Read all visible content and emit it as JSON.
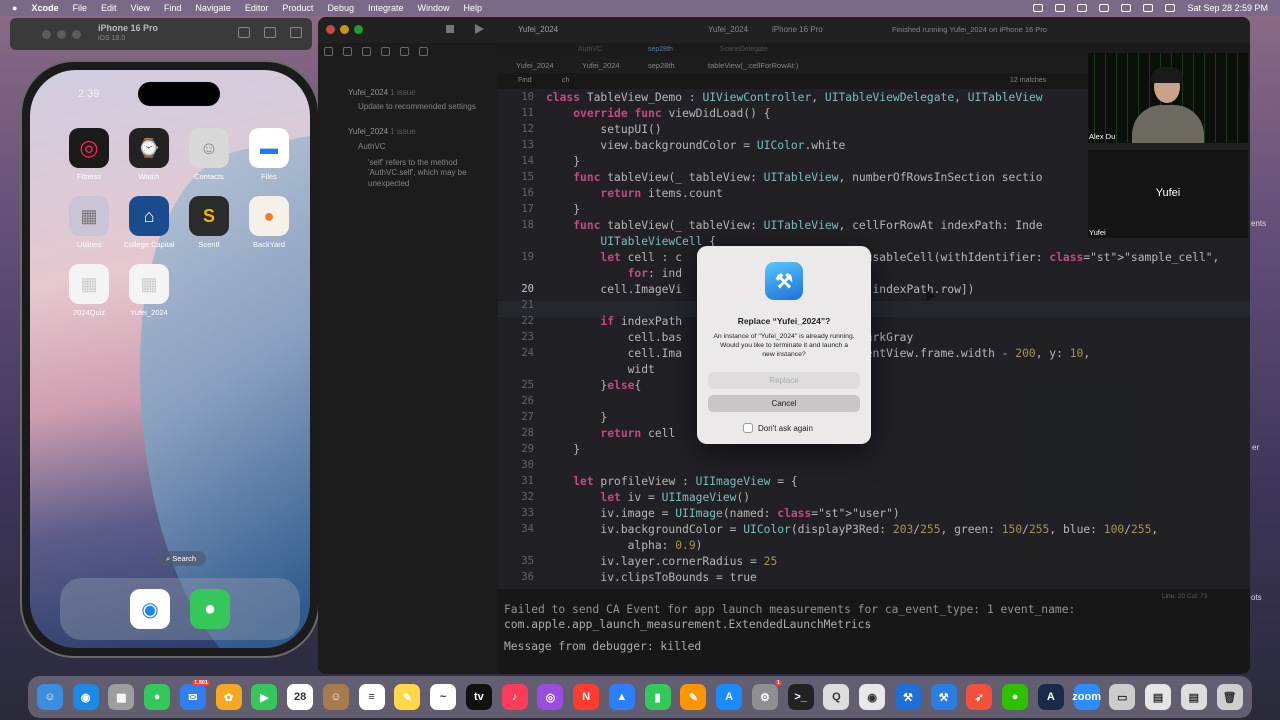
{
  "menubar": {
    "app": "Xcode",
    "items": [
      "File",
      "Edit",
      "View",
      "Find",
      "Navigate",
      "Editor",
      "Product",
      "Debug",
      "Integrate",
      "Window",
      "Help"
    ],
    "clock": "Sat Sep 28  2:59 PM"
  },
  "simulator": {
    "title": "iPhone 16 Pro",
    "subtitle": "iOS 18.0",
    "time": "2:39",
    "apps": [
      {
        "label": "Fitness",
        "icon": "fitness-icon",
        "color": "#1b1b1b",
        "glyph": "◎"
      },
      {
        "label": "Watch",
        "icon": "watch-icon",
        "color": "#222",
        "glyph": "⌚"
      },
      {
        "label": "Contacts",
        "icon": "contacts-icon",
        "color": "#d8d8d8",
        "glyph": "☺"
      },
      {
        "label": "Files",
        "icon": "files-icon",
        "color": "#fff",
        "glyph": "▬"
      },
      {
        "label": "Utilities",
        "icon": "utilities-icon",
        "color": "#c9c4d6",
        "glyph": "▦"
      },
      {
        "label": "College Capital",
        "icon": "college-capital-icon",
        "color": "#1a4b8c",
        "glyph": "⌂"
      },
      {
        "label": "ScenIf",
        "icon": "scenif-icon",
        "color": "#2b2b2b",
        "glyph": "S"
      },
      {
        "label": "BackYard",
        "icon": "backyard-icon",
        "color": "#f5f0e8",
        "glyph": "●"
      },
      {
        "label": "2024Quiz",
        "icon": "quiz-icon",
        "color": "#f4f4f4",
        "glyph": "▦"
      },
      {
        "label": "Yufei_2024",
        "icon": "yufei-app-icon",
        "color": "#f4f4f4",
        "glyph": "▦"
      }
    ],
    "search_label": "Search",
    "dock": [
      {
        "icon": "safari-icon",
        "glyph": "◉",
        "color": "#fff"
      },
      {
        "icon": "messages-icon",
        "glyph": "●",
        "color": "#35c759"
      }
    ]
  },
  "xcode": {
    "project": "Yufei_2024",
    "scheme": "Yufei_2024",
    "device": "iPhone 16 Pro",
    "status": "Finished running Yufei_2024 on iPhone 16 Pro",
    "tabs": [
      "AuthVC",
      "sep28th",
      "SceneDelegate"
    ],
    "jumpbar": [
      "Yufei_2024",
      "Yufei_2024",
      "sep28th",
      "tableView(_:cellForRowAt:)"
    ],
    "find_label": "Find",
    "find_value": "ch",
    "find_matches": "12 matches",
    "issues": {
      "group1": "Yufei_2024",
      "group1_count": "1 issue",
      "item1": "Update to recommended settings",
      "group2": "Yufei_2024",
      "group2_count": "1 issue",
      "file": "AuthVC",
      "item2": "'self' refers to the method 'AuthVC.self', which may be unexpected"
    },
    "line_col": "Line: 20  Col: 73",
    "console": [
      "Failed to send CA Event for app launch measurements for ca_event_type: 1 event_name:",
      "com.apple.app_launch_measurement.ExtendedLaunchMetrics",
      "Message from debugger: killed"
    ]
  },
  "code_lines": [
    {
      "n": "10",
      "t": "class TableView_Demo : UIViewController, UITableViewDelegate, UITableView"
    },
    {
      "n": "11",
      "t": "    override func viewDidLoad() {"
    },
    {
      "n": "12",
      "t": "        setupUI()"
    },
    {
      "n": "13",
      "t": "        view.backgroundColor = UIColor.white"
    },
    {
      "n": "14",
      "t": "    }"
    },
    {
      "n": "15",
      "t": "    func tableView(_ tableView: UITableView, numberOfRowsInSection sectio"
    },
    {
      "n": "16",
      "t": "        return items.count"
    },
    {
      "n": "17",
      "t": "    }"
    },
    {
      "n": "18",
      "t": "    func tableView(_ tableView: UITableView, cellForRowAt indexPath: Inde"
    },
    {
      "n": "",
      "t": "        UITableViewCell {"
    },
    {
      "n": "19",
      "t": "        let cell : c                  dequeueReusableCell(withIdentifier: \"sample_cell\","
    },
    {
      "n": "",
      "t": "            for: ind                  cell"
    },
    {
      "n": "20",
      "t": "        cell.ImageVi              emName:images[indexPath.row])"
    },
    {
      "n": "21",
      "t": ""
    },
    {
      "n": "22",
      "t": "        if indexPath"
    },
    {
      "n": "23",
      "t": "            cell.bas                  UIColor.darkGray"
    },
    {
      "n": "24",
      "t": "            cell.Ima                : cell.contentView.frame.width - 200, y: 10,"
    },
    {
      "n": "",
      "t": "            widt"
    },
    {
      "n": "25",
      "t": "        }else{"
    },
    {
      "n": "26",
      "t": ""
    },
    {
      "n": "27",
      "t": "        }"
    },
    {
      "n": "28",
      "t": "        return cell"
    },
    {
      "n": "29",
      "t": "    }"
    },
    {
      "n": "30",
      "t": ""
    },
    {
      "n": "31",
      "t": "    let profileView : UIImageView = {"
    },
    {
      "n": "32",
      "t": "        let iv = UIImageView()"
    },
    {
      "n": "33",
      "t": "        iv.image = UIImage(named: \"user\")"
    },
    {
      "n": "34",
      "t": "        iv.backgroundColor = UIColor(displayP3Red: 203/255, green: 150/255, blue: 100/255,"
    },
    {
      "n": "",
      "t": "            alpha: 0.9)"
    },
    {
      "n": "35",
      "t": "        iv.layer.cornerRadius = 25"
    },
    {
      "n": "36",
      "t": "        iv.clipsToBounds = true"
    }
  ],
  "dialog": {
    "icon": "xcode-app-icon",
    "title": "Replace “Yufei_2024”?",
    "message": "An instance of \"Yufei_2024\" is already running. Would you like to terminate it and launch a new instance?",
    "replace": "Replace",
    "cancel": "Cancel",
    "checkbox": "Don't ask again"
  },
  "video": {
    "tile1_name": "Alex Du",
    "tile2_label": "Yufei",
    "tile2_name": "Yufei"
  },
  "edge_labels": [
    "ents",
    "er",
    "ots"
  ],
  "dock_apps": [
    {
      "icon": "finder-icon",
      "color": "#3b8de0",
      "txt": "☺"
    },
    {
      "icon": "safari-icon",
      "color": "#1e88e5",
      "txt": "◉"
    },
    {
      "icon": "launchpad-icon",
      "color": "#9e9e9e",
      "txt": "▦"
    },
    {
      "icon": "messages-icon",
      "color": "#34c759",
      "txt": "●"
    },
    {
      "icon": "mail-icon",
      "color": "#2f7ff0",
      "txt": "✉",
      "badge": "1,801"
    },
    {
      "icon": "photos-icon",
      "color": "#f5a623",
      "txt": "✿"
    },
    {
      "icon": "facetime-icon",
      "color": "#34c759",
      "txt": "▶"
    },
    {
      "icon": "calendar-icon",
      "color": "#ffffff",
      "txt": "28"
    },
    {
      "icon": "contacts-icon",
      "color": "#a87b4f",
      "txt": "☺"
    },
    {
      "icon": "reminders-icon",
      "color": "#ffffff",
      "txt": "≡"
    },
    {
      "icon": "notes-icon",
      "color": "#ffd84a",
      "txt": "✎"
    },
    {
      "icon": "freeform-icon",
      "color": "#ffffff",
      "txt": "~"
    },
    {
      "icon": "appletv-icon",
      "color": "#111111",
      "txt": "tv"
    },
    {
      "icon": "music-icon",
      "color": "#fa3c5a",
      "txt": "♪"
    },
    {
      "icon": "podcasts-icon",
      "color": "#9b4dde",
      "txt": "◎"
    },
    {
      "icon": "news-icon",
      "color": "#ff3b30",
      "txt": "N"
    },
    {
      "icon": "keynote-icon",
      "color": "#2d7ff9",
      "txt": "▲"
    },
    {
      "icon": "numbers-icon",
      "color": "#34c759",
      "txt": "▮"
    },
    {
      "icon": "pages-icon",
      "color": "#ff9500",
      "txt": "✎"
    },
    {
      "icon": "appstore-icon",
      "color": "#1a8cff",
      "txt": "A"
    },
    {
      "icon": "settings-icon",
      "color": "#8e8e93",
      "txt": "⚙",
      "badge": "1"
    },
    {
      "icon": "terminal-icon",
      "color": "#222222",
      "txt": ">_"
    },
    {
      "icon": "quicktime-icon",
      "color": "#dddddd",
      "txt": "Q"
    },
    {
      "icon": "chrome-icon",
      "color": "#e8e8e8",
      "txt": "◉"
    },
    {
      "icon": "xcode-icon",
      "color": "#1e6fd8",
      "txt": "⚒"
    },
    {
      "icon": "xcode-beta-icon",
      "color": "#2a7de1",
      "txt": "⚒"
    },
    {
      "icon": "swift-playgrounds-icon",
      "color": "#f05138",
      "txt": "➶"
    },
    {
      "icon": "wechat-icon",
      "color": "#2dc100",
      "txt": "●"
    },
    {
      "icon": "instruments-icon",
      "color": "#1c2a4a",
      "txt": "A"
    },
    {
      "icon": "zoom-icon",
      "color": "#2d8cff",
      "txt": "zoom"
    },
    {
      "icon": "screensharing-icon",
      "color": "#cccccc",
      "txt": "▭"
    },
    {
      "icon": "preview-icon",
      "color": "#e5e5e5",
      "txt": "▤"
    },
    {
      "icon": "downloads-icon",
      "color": "#dddddd",
      "txt": "▤"
    },
    {
      "icon": "trash-icon",
      "color": "#cfcfcf",
      "txt": "🗑"
    }
  ]
}
